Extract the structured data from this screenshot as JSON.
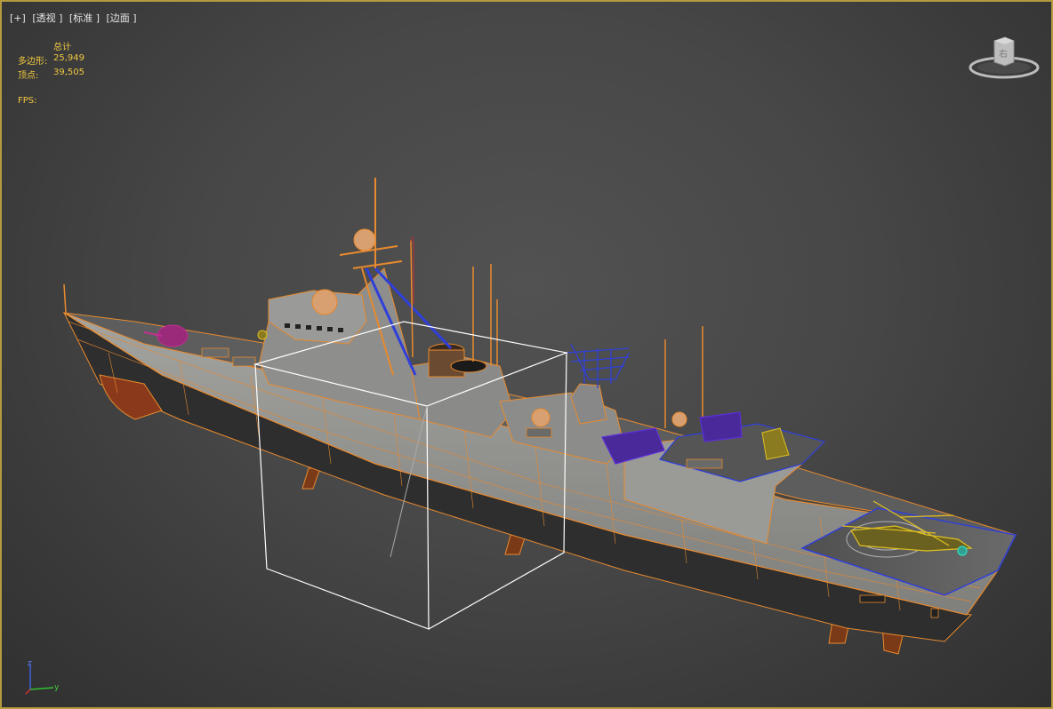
{
  "viewport": {
    "label_plus": "[+]",
    "label_view": "[透视 ]",
    "label_shading": "[标准 ]",
    "label_edges": "[边面 ]",
    "border_color": "#b59a3e"
  },
  "stats": {
    "total_label": "总计",
    "polys_label": "多边形:",
    "polys_value": "25,949",
    "verts_label": "顶点:",
    "verts_value": "39,505",
    "fps_label": "FPS:"
  },
  "viewcube": {
    "face_label": "右"
  },
  "gizmo": {
    "pivot_label": "z"
  },
  "axis_tripod": {
    "z_label": "z",
    "y_label": "y"
  },
  "colors": {
    "wireframe": "#e88a2e",
    "hull": "#8e8e8c",
    "selection": "#2f3fd9",
    "helicopter": "#e0c020",
    "text": "#f0c840"
  }
}
